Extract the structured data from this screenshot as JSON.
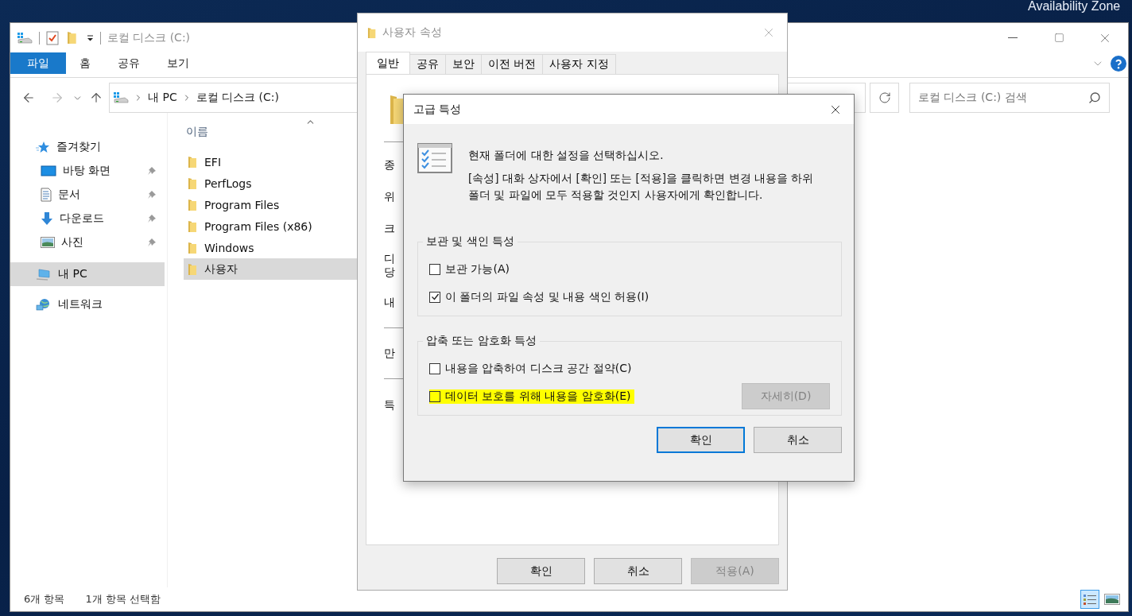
{
  "desktop": {
    "text": "Availability Zone"
  },
  "explorer": {
    "title": "로컬 디스크 (C:)",
    "ribbon_tabs": [
      {
        "label": "파일",
        "kind": "menu"
      },
      {
        "label": "홈",
        "kind": "tab"
      },
      {
        "label": "공유",
        "kind": "tab"
      },
      {
        "label": "보기",
        "kind": "tab"
      }
    ],
    "breadcrumb": [
      "내 PC",
      "로컬 디스크 (C:)"
    ],
    "search": {
      "placeholder": "로컬 디스크 (C:) 검색"
    },
    "nav": [
      {
        "label": "즐겨찾기",
        "selected": false,
        "children": [
          {
            "label": "바탕 화면",
            "pinned": true,
            "selected": false
          },
          {
            "label": "문서",
            "pinned": true,
            "selected": false
          },
          {
            "label": "다운로드",
            "pinned": true,
            "selected": false
          },
          {
            "label": "사진",
            "pinned": true,
            "selected": false
          }
        ]
      },
      {
        "label": "내 PC",
        "selected": true
      },
      {
        "label": "네트워크",
        "selected": false
      }
    ],
    "column": "이름",
    "files": [
      {
        "name": "EFI",
        "selected": false
      },
      {
        "name": "PerfLogs",
        "selected": false
      },
      {
        "name": "Program Files",
        "selected": false
      },
      {
        "name": "Program Files (x86)",
        "selected": false
      },
      {
        "name": "Windows",
        "selected": false
      },
      {
        "name": "사용자",
        "selected": true
      }
    ],
    "status": [
      "6개 항목",
      "1개 항목 선택함"
    ],
    "views": [
      {
        "selected": true
      },
      {
        "selected": false
      }
    ]
  },
  "properties": {
    "title": "사용자 속성",
    "tabs": [
      {
        "label": "일반",
        "selected": true
      },
      {
        "label": "공유",
        "selected": false
      },
      {
        "label": "보안",
        "selected": false
      },
      {
        "label": "이전 버전",
        "selected": false
      },
      {
        "label": "사용자 지정",
        "selected": false
      }
    ],
    "rows": [
      {
        "lines": [
          "종"
        ],
        "divider_after": false
      },
      {
        "lines": [
          "위"
        ],
        "divider_after": false
      },
      {
        "lines": [
          "크"
        ],
        "divider_after": false
      },
      {
        "lines": [
          "디",
          "당"
        ],
        "divider_after": false
      },
      {
        "lines": [
          "내"
        ],
        "divider_after": true
      },
      {
        "lines": [
          "만"
        ],
        "divider_after": true
      },
      {
        "lines": [
          "특"
        ],
        "divider_after": false
      }
    ],
    "buttons": [
      {
        "label": "확인",
        "disabled": false
      },
      {
        "label": "취소",
        "disabled": false
      },
      {
        "label": "적용(A)",
        "disabled": true
      }
    ]
  },
  "advanced": {
    "title": "고급 특성",
    "heading": "현재 폴더에 대한 설정을 선택하십시오.",
    "description": "[속성] 대화 상자에서 [확인] 또는 [적용]을 클릭하면 변경 내용을 하위 폴더 및 파일에 모두 적용할 것인지 사용자에게 확인합니다.",
    "groups": [
      {
        "title": "보관 및 색인 특성",
        "options": [
          {
            "label": "보관 가능(A)",
            "checked": false,
            "highlighted": false
          },
          {
            "label": "이 폴더의 파일 속성 및 내용 색인 허용(I)",
            "checked": true,
            "highlighted": false
          }
        ]
      },
      {
        "title": "압축 또는 암호화 특성",
        "options": [
          {
            "label": "내용을 압축하여 디스크 공간 절약(C)",
            "checked": false,
            "highlighted": false
          },
          {
            "label": "데이터 보호를 위해 내용을 암호화(E)",
            "checked": false,
            "highlighted": true
          }
        ],
        "button": {
          "label": "자세히(D)",
          "disabled": true
        }
      }
    ],
    "buttons": [
      {
        "label": "확인",
        "default": true
      },
      {
        "label": "취소",
        "default": false
      }
    ]
  }
}
